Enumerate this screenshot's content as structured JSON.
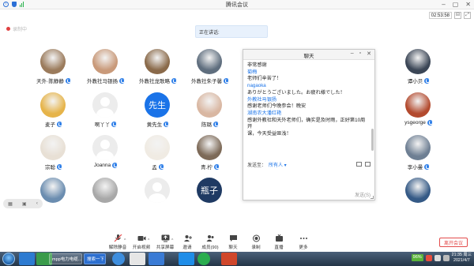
{
  "app": {
    "title": "腾讯会议",
    "timer": "02:53:58",
    "recording_label": "录制中",
    "speaking_label": "正在讲话:"
  },
  "participants": [
    {
      "name": "天外·陈静静",
      "avatar": "photo",
      "color": "#9b7b5c"
    },
    {
      "name": "外教社马银扬",
      "avatar": "photo",
      "color": "#c99a7a"
    },
    {
      "name": "外教社龙歌略",
      "avatar": "photo",
      "color": "#8a6a4a"
    },
    {
      "name": "外教社朱子馨",
      "avatar": "photo",
      "color": "#5f6e7e"
    },
    {
      "name": "",
      "avatar": "hidden"
    },
    {
      "name": "",
      "avatar": "hidden"
    },
    {
      "name": "",
      "avatar": "hidden"
    },
    {
      "name": "谭小贝",
      "avatar": "photo",
      "color": "#3b4656"
    },
    {
      "name": "麦子",
      "avatar": "photo",
      "color": "#e6b44a"
    },
    {
      "name": "啊丫丫",
      "avatar": "grey"
    },
    {
      "name": "黄先生",
      "avatar": "text",
      "text": "先生"
    },
    {
      "name": "陈璐",
      "avatar": "photo",
      "color": "#d9b7a2"
    },
    {
      "name": "",
      "avatar": "hidden"
    },
    {
      "name": "",
      "avatar": "hidden"
    },
    {
      "name": "",
      "avatar": "hidden"
    },
    {
      "name": "ysgeorge",
      "avatar": "photo",
      "color": "#b34a2e"
    },
    {
      "name": "宗聪",
      "avatar": "photo",
      "color": "#e8e0d5"
    },
    {
      "name": "Joanna",
      "avatar": "grey"
    },
    {
      "name": "孟",
      "avatar": "photo",
      "color": "#f0ebe3"
    },
    {
      "name": "青.柠",
      "avatar": "photo",
      "color": "#7d6a58"
    },
    {
      "name": "",
      "avatar": "hidden"
    },
    {
      "name": "",
      "avatar": "hidden"
    },
    {
      "name": "",
      "avatar": "hidden"
    },
    {
      "name": "李小曼",
      "avatar": "photo",
      "color": "#6e7f93"
    },
    {
      "name": "",
      "avatar": "photo",
      "color": "#6b8db0"
    },
    {
      "name": "",
      "avatar": "photo",
      "color": "#a8a8a8"
    },
    {
      "name": "",
      "avatar": "grey"
    },
    {
      "name": "",
      "avatar": "text",
      "text": "瓶子",
      "dark": true
    },
    {
      "name": "",
      "avatar": "hidden"
    },
    {
      "name": "",
      "avatar": "hidden"
    },
    {
      "name": "",
      "avatar": "hidden"
    },
    {
      "name": "",
      "avatar": "photo",
      "color": "#355a86"
    }
  ],
  "chat": {
    "title": "聊天",
    "messages": [
      {
        "type": "body",
        "text": "非常感谢"
      },
      {
        "type": "sender",
        "text": "菊梅"
      },
      {
        "type": "body",
        "text": "老师们辛苦了！"
      },
      {
        "type": "sender",
        "text": "nagaoka"
      },
      {
        "type": "body",
        "text": "ありがとうございました。お疲れ様でした！"
      },
      {
        "type": "sender",
        "text": "外教社马银扬"
      },
      {
        "type": "body",
        "text": "感谢老师们今晚参会！晚安"
      },
      {
        "type": "sender",
        "text": "湖南农大潘红艳"
      },
      {
        "type": "body",
        "text": "感谢外教社和天外老师们，确实是及时雨，正好第10周开"
      },
      {
        "type": "body",
        "text": "课，今天受益匪浅！"
      }
    ],
    "send_to_label": "发送至：",
    "send_to_value": "所有人 ▾",
    "send_button": "发送(S)"
  },
  "toolbar": {
    "items": [
      {
        "label": "解除静音",
        "icon": "mic-muted-icon"
      },
      {
        "label": "开启视频",
        "icon": "video-icon"
      },
      {
        "label": "共享屏幕",
        "icon": "share-screen-icon"
      },
      {
        "label": "邀请",
        "icon": "invite-icon"
      },
      {
        "label": "成员(90)",
        "icon": "members-icon"
      },
      {
        "label": "聊天",
        "icon": "chat-icon"
      },
      {
        "label": "录制",
        "icon": "record-icon"
      },
      {
        "label": "直播",
        "icon": "live-icon"
      },
      {
        "label": "更多",
        "icon": "more-icon"
      }
    ],
    "end_meeting": "离开会议"
  },
  "taskbar": {
    "window_1": "mpp电力电缆...",
    "window_2": "搜索一下",
    "battery": "96%",
    "time": "21:35 周三",
    "date": "2021/4/7"
  },
  "colors": {
    "accent": "#1a73e8",
    "danger": "#e34b4b"
  }
}
